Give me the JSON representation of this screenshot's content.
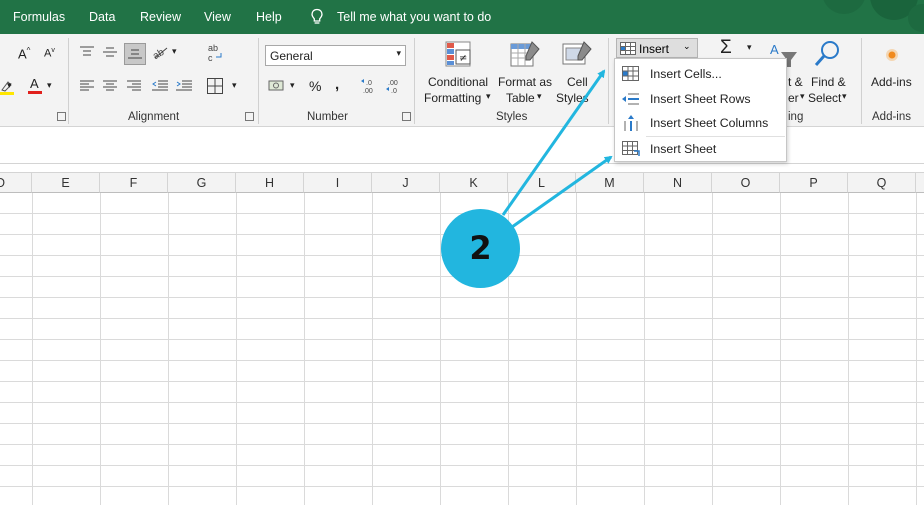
{
  "menu": {
    "tabs": [
      "Formulas",
      "Data",
      "Review",
      "View",
      "Help"
    ],
    "tell_me": "Tell me what you want to do"
  },
  "ribbon": {
    "alignment_label": "Alignment",
    "number_label": "Number",
    "number_format": "General",
    "styles_label": "Styles",
    "conditional_formatting": [
      "Conditional",
      "Formatting"
    ],
    "format_as_table": [
      "Format as",
      "Table"
    ],
    "cell_styles": [
      "Cell",
      "Styles"
    ],
    "insert_label": "Insert",
    "partial_fill": "t &",
    "partial_ter": "er",
    "partial_editing": "ing",
    "find_select": [
      "Find &",
      "Select"
    ],
    "addins": "Add-ins",
    "addins_group": "Add-ins"
  },
  "insert_menu": {
    "items": [
      "Insert Cells...",
      "Insert Sheet Rows",
      "Insert Sheet Columns",
      "Insert Sheet"
    ]
  },
  "columns": [
    "D",
    "E",
    "F",
    "G",
    "H",
    "I",
    "J",
    "K",
    "L",
    "M",
    "N",
    "O",
    "P",
    "Q"
  ],
  "annotation": {
    "step": "2",
    "color": "#22b6df"
  },
  "colors": {
    "excel_green": "#217346",
    "font_color_red": "#e0201b",
    "highlight_yellow": "#ffe600"
  }
}
